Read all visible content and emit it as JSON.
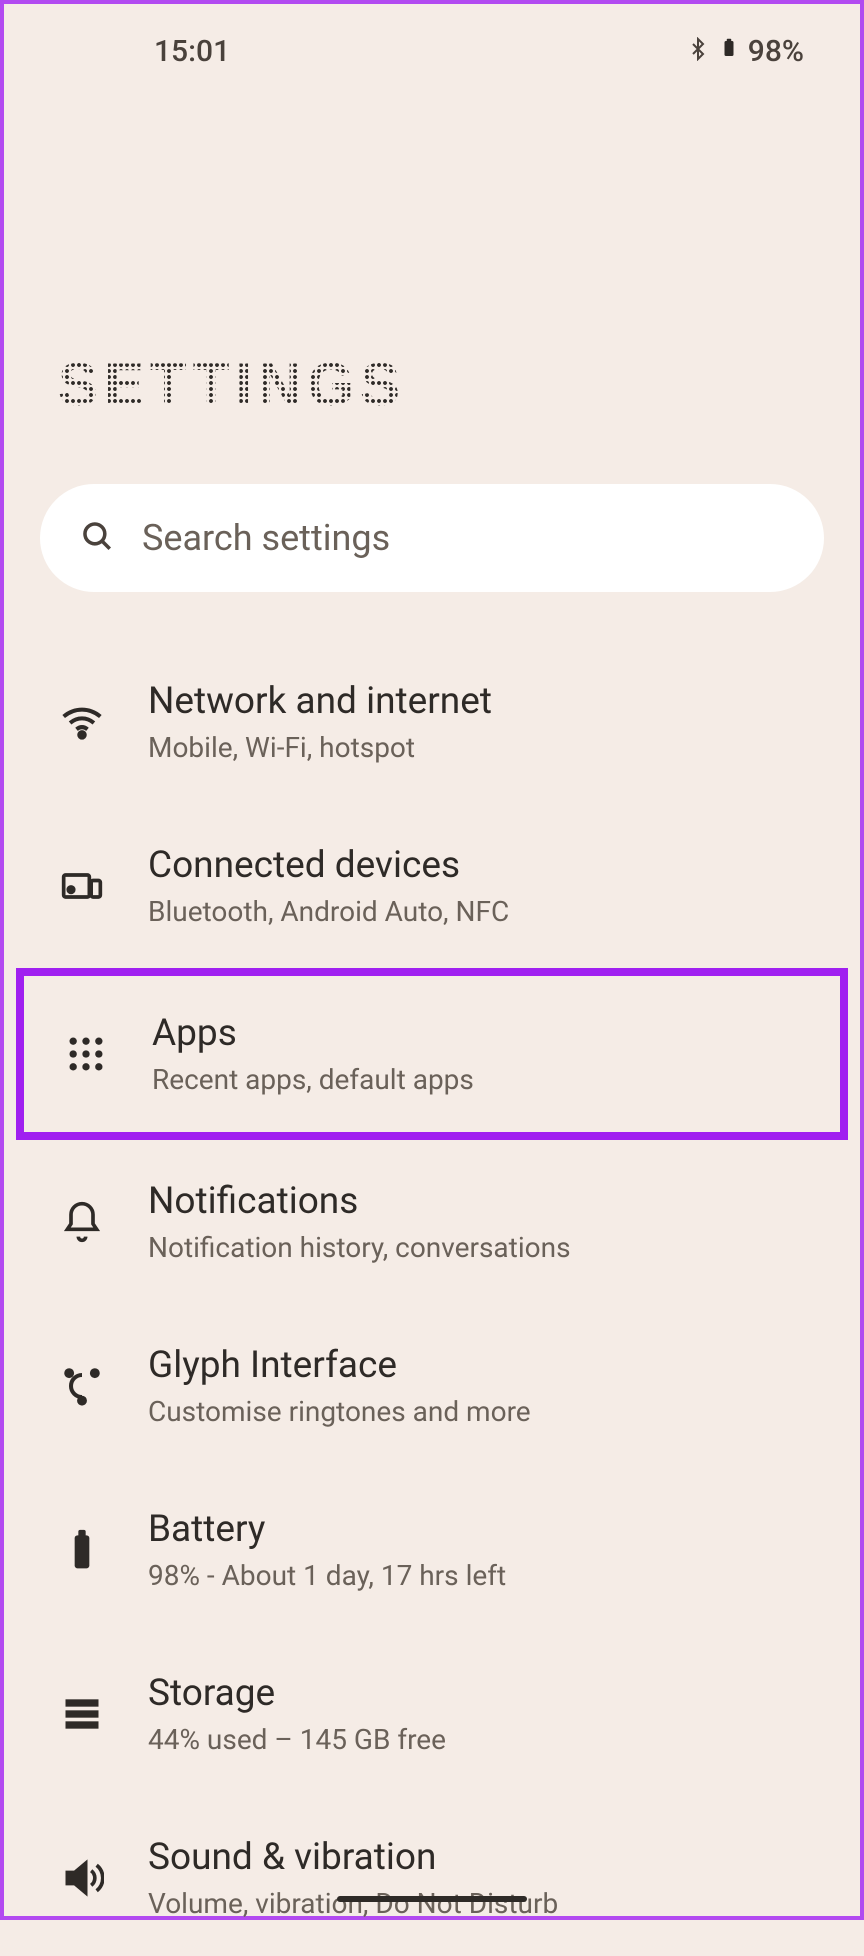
{
  "statusbar": {
    "time": "15:01",
    "battery_pct": "98%"
  },
  "page": {
    "title": "SETTINGS"
  },
  "search": {
    "placeholder": "Search settings"
  },
  "items": [
    {
      "title": "Network and internet",
      "subtitle": "Mobile, Wi-Fi, hotspot",
      "icon": "wifi-icon",
      "highlighted": false
    },
    {
      "title": "Connected devices",
      "subtitle": "Bluetooth, Android Auto, NFC",
      "icon": "devices-icon",
      "highlighted": false
    },
    {
      "title": "Apps",
      "subtitle": "Recent apps, default apps",
      "icon": "apps-icon",
      "highlighted": true
    },
    {
      "title": "Notifications",
      "subtitle": "Notification history, conversations",
      "icon": "bell-icon",
      "highlighted": false
    },
    {
      "title": "Glyph Interface",
      "subtitle": "Customise ringtones and more",
      "icon": "glyph-icon",
      "highlighted": false
    },
    {
      "title": "Battery",
      "subtitle": "98% - About 1 day, 17 hrs left",
      "icon": "battery-icon",
      "highlighted": false
    },
    {
      "title": "Storage",
      "subtitle": "44% used – 145 GB free",
      "icon": "storage-icon",
      "highlighted": false
    },
    {
      "title": "Sound & vibration",
      "subtitle": "Volume, vibration, Do Not Disturb",
      "icon": "sound-icon",
      "highlighted": false
    }
  ]
}
